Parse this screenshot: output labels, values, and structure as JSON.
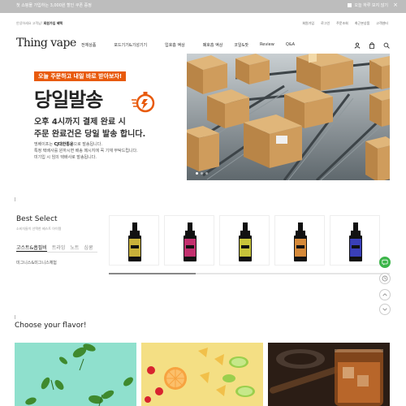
{
  "topbar": {
    "promo": "첫 쇼핑몰 가입하는 3,000원 할인 쿠폰 증정",
    "dismiss_label": "오늘 하루 보지 않기",
    "close": "×"
  },
  "util": {
    "welcome_prefix": "안녕하세요 고객님!",
    "welcome_bold": "회원가입 혜택",
    "links": [
      "회원가입",
      "로그인",
      "주문조회",
      "최근본상품",
      "고객센터"
    ]
  },
  "logo": "Thing vape",
  "menu": [
    "전체상품",
    "포드기기&기성기기",
    "입호흡 액상",
    "폐호흡 액상",
    "코일&팟",
    "Review",
    "Q&A"
  ],
  "icons": [
    "user-icon",
    "cart-icon",
    "search-icon"
  ],
  "hero": {
    "tag": "오늘 주문하고 내일 바로 받아보자!",
    "title": "당일발송",
    "sub1": "오후 4시까지 결제 완료 시",
    "sub2": "주문 완료건은 당일 발송 합니다.",
    "desc_prefix": "띵베이프는",
    "desc_bold": "CJ대한통운",
    "desc_suffix": "으로 발송됩니다.",
    "desc2": "특정 택배사를 원하시면 배송 메시지에 꼭 기재 부탁드립니다.",
    "desc3": "미기입 시 임의 택배사로 발송됩니다."
  },
  "best": {
    "title": "Best Select",
    "subtitle": "소비자들이 선택한 베스트 아이템",
    "tabs": [
      "고스트&흡필비",
      "트라잉",
      "노트",
      "심쿵"
    ],
    "active_tab": 0,
    "brand": "미그니스&미그니스체험"
  },
  "products": [
    {
      "name": "product-1",
      "color": "#c9b13a"
    },
    {
      "name": "product-2",
      "color": "#c2306e"
    },
    {
      "name": "product-3",
      "color": "#c8c43a"
    },
    {
      "name": "product-4",
      "color": "#d68a3a"
    },
    {
      "name": "product-5",
      "color": "#3a3fb8"
    }
  ],
  "carousel_progress": 0.31,
  "choose_title": "Choose your flavor!",
  "colors": {
    "accent": "#e85a0c",
    "chat": "#3cb54a"
  }
}
